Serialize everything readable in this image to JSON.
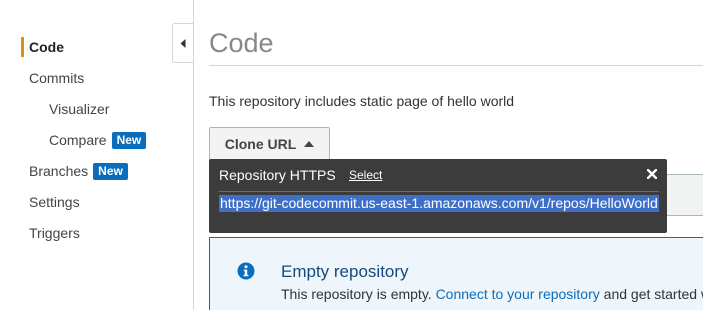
{
  "sidebar": {
    "items": [
      {
        "label": "Code"
      },
      {
        "label": "Commits"
      },
      {
        "label": "Visualizer"
      },
      {
        "label": "Compare",
        "badge": "New"
      },
      {
        "label": "Branches",
        "badge": "New"
      },
      {
        "label": "Settings"
      },
      {
        "label": "Triggers"
      }
    ],
    "active_color": "#e88a1a",
    "badge_color": "#0a6ebd"
  },
  "main": {
    "title": "Code",
    "description": "This repository includes static page of hello world",
    "clone_button": {
      "label": "Clone URL",
      "icon": "caret-up-icon"
    }
  },
  "popover": {
    "title": "Repository HTTPS",
    "select_label": "Select",
    "close_icon": "close-icon",
    "url": "https://git-codecommit.us-east-1.amazonaws.com/v1/repos/HelloWorld"
  },
  "alert": {
    "icon": "info-icon",
    "title": "Empty repository",
    "text_before": "This repository is empty.",
    "link_text": "Connect to your repository",
    "text_after": "and get started w"
  }
}
